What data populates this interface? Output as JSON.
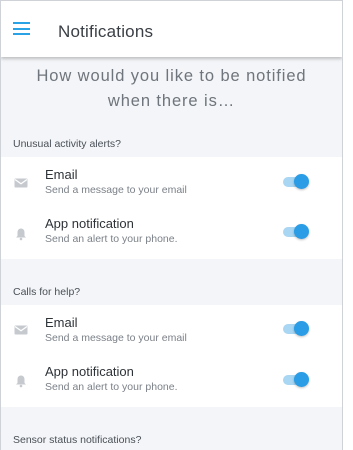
{
  "header": {
    "title": "Notifications"
  },
  "intro": {
    "line1": "How would you like to be notified",
    "line2": "when there is…"
  },
  "sections": [
    {
      "title": "Unusual activity alerts?",
      "items": [
        {
          "icon": "email-icon",
          "title": "Email",
          "subtitle": "Send a message to your email",
          "enabled": true
        },
        {
          "icon": "bell-icon",
          "title": "App notification",
          "subtitle": "Send an alert to your phone.",
          "enabled": true
        }
      ]
    },
    {
      "title": "Calls for help?",
      "items": [
        {
          "icon": "email-icon",
          "title": "Email",
          "subtitle": "Send a message to your email",
          "enabled": true
        },
        {
          "icon": "bell-icon",
          "title": "App notification",
          "subtitle": "Send an alert to your phone.",
          "enabled": true
        }
      ]
    },
    {
      "title": "Sensor status notifications?",
      "items": []
    }
  ],
  "colors": {
    "accent": "#2a9de6",
    "track": "#a9d6f2",
    "background": "#f3f5f8",
    "icon": "#c6cacf"
  }
}
